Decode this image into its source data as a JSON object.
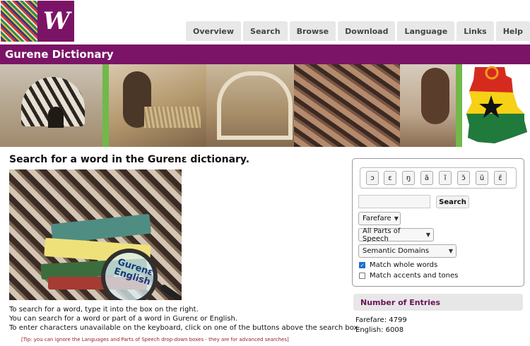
{
  "nav": [
    "Overview",
    "Search",
    "Browse",
    "Download",
    "Language",
    "Links",
    "Help"
  ],
  "logo_letter": "W",
  "title": "Gurene Dictionary",
  "heading": "Search for a word in the Gurenɛ dictionary.",
  "book_image": {
    "lens_line1": "Gurenɛ",
    "lens_line2": "English"
  },
  "help_lines": [
    "To search for a word, type it into the box on the right.",
    "You can search for a word or part of a word in Gurenɛ or English.",
    "To enter characters unavailable on the keyboard, click on one of the buttons above the search box."
  ],
  "tip": "[Tip: you can ignore the Languages and Parts of Speech drop-down boxes - they are for advanced searches]",
  "search": {
    "chars": [
      "ɔ",
      "ɛ",
      "ŋ",
      "ã",
      "ĩ",
      "ɔ̃",
      "ũ",
      "ɛ̃"
    ],
    "input_value": "",
    "button": "Search",
    "language": "Farefare",
    "parts_of_speech": "All Parts of Speech",
    "semantic_domains": "Semantic Domains",
    "match_whole": {
      "label": "Match whole words",
      "checked": true
    },
    "match_accents": {
      "label": "Match accents and tones",
      "checked": false
    }
  },
  "entries": {
    "heading": "Number of Entries",
    "lines": [
      "Farefare: 4799",
      "English: 6008"
    ]
  },
  "colors": {
    "brand": "#7b1466",
    "accent_green": "#72b84a"
  }
}
